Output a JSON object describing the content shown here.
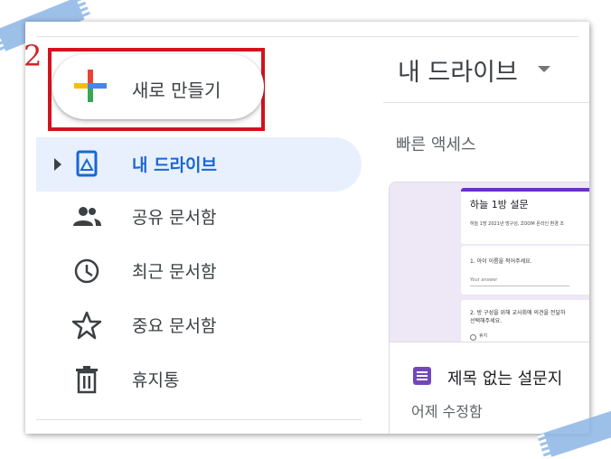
{
  "step_marker": "2",
  "new_button": {
    "label": "새로 만들기"
  },
  "sidebar": {
    "items": [
      {
        "label": "내 드라이브",
        "icon": "drive-icon",
        "active": true
      },
      {
        "label": "공유 문서함",
        "icon": "people-icon"
      },
      {
        "label": "최근 문서함",
        "icon": "clock-icon"
      },
      {
        "label": "중요 문서함",
        "icon": "star-icon"
      },
      {
        "label": "휴지통",
        "icon": "trash-icon"
      }
    ]
  },
  "main": {
    "title": "내 드라이브",
    "quick_access_label": "빠른 액세스",
    "file": {
      "name": "제목 없는 설문지",
      "time": "어제 수정함",
      "icon": "google-forms-icon",
      "preview": {
        "form_title": "하늘 1방 설문",
        "description": "하늘 1방 2021년 방구성, ZOOM 온라인 환경 조",
        "q1": "1. 아이 이름을 적어주세요.",
        "q1_answer": "Your answer",
        "q2": "2. 방 구성을 위해 교사회에 의견을 전달하",
        "q2_cont": "선택해주세요.",
        "q2_option": "휴지"
      }
    }
  },
  "colors": {
    "accent_blue": "#1967d2",
    "active_bg": "#e8f0fe",
    "highlight_red": "#d4121e",
    "forms_purple": "#7248b9"
  }
}
